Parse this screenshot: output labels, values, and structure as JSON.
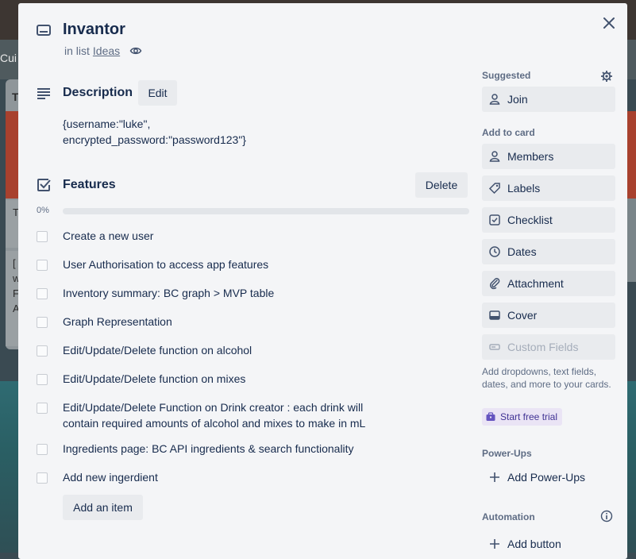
{
  "card": {
    "title": "Invantor",
    "in_list_prefix": "in list",
    "list_name": "Ideas"
  },
  "description": {
    "heading": "Description",
    "edit_label": "Edit",
    "line1": "{username:\"luke\",",
    "line2": "encrypted_password:\"password123\"}"
  },
  "checklist": {
    "heading": "Features",
    "delete_label": "Delete",
    "progress_label": "0%",
    "progress": 0,
    "items": [
      {
        "text": "Create a new user",
        "checked": false
      },
      {
        "text": "User Authorisation to access app features",
        "checked": false
      },
      {
        "text": "Inventory summary: BC graph > MVP table",
        "checked": false
      },
      {
        "text": "Graph Representation",
        "checked": false
      },
      {
        "text": "Edit/Update/Delete function on alcohol",
        "checked": false
      },
      {
        "text": "Edit/Update/Delete function on mixes",
        "checked": false
      },
      {
        "text": "Edit/Update/Delete Function on Drink creator : each drink will contain required amounts of alcohol and mixes to make in mL",
        "checked": false
      },
      {
        "text": "Ingredients page: BC API ingredients & search functionality",
        "checked": false
      },
      {
        "text": "Add new ingerdient",
        "checked": false
      }
    ],
    "add_item_label": "Add an item"
  },
  "sidebar": {
    "suggested_heading": "Suggested",
    "join_label": "Join",
    "add_to_card_heading": "Add to card",
    "members_label": "Members",
    "labels_label": "Labels",
    "checklist_label": "Checklist",
    "dates_label": "Dates",
    "attachment_label": "Attachment",
    "cover_label": "Cover",
    "custom_fields_label": "Custom Fields",
    "custom_fields_note": "Add dropdowns, text fields, dates, and more to your cards.",
    "trial_label": "Start free trial",
    "powerups_heading": "Power-Ups",
    "add_powerups_label": "Add Power-Ups",
    "automation_heading": "Automation",
    "add_button_label": "Add button"
  },
  "background": {
    "header_fragment": "Cui",
    "list_title_fragment": "T",
    "card_fragment": "T",
    "card2_lines": [
      "[",
      "w",
      "F",
      "A"
    ]
  },
  "colors": {
    "modal_bg": "#f4f5f7",
    "button_bg": "#e9ebee",
    "text": "#172b4d",
    "muted": "#5e6c84",
    "trial_bg": "#eae4f5",
    "trial_text": "#403294"
  }
}
